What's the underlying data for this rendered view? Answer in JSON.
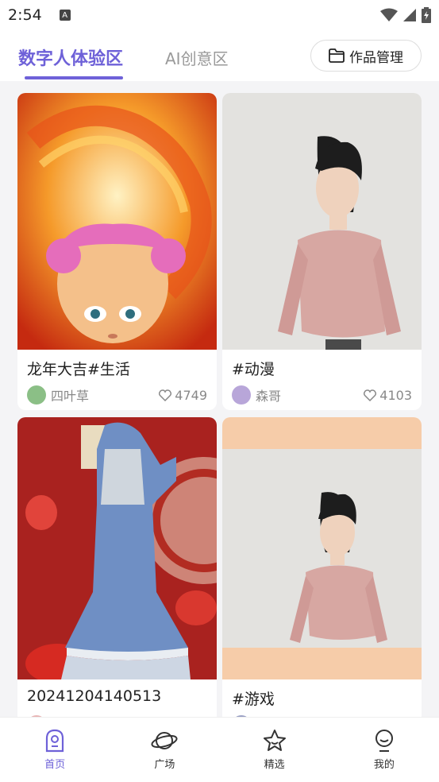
{
  "status_bar": {
    "time": "2:54",
    "notification_icon": "A"
  },
  "header": {
    "tabs": [
      {
        "label": "数字人体验区",
        "active": true
      },
      {
        "label": "AI创意区",
        "active": false
      }
    ],
    "manage_button": "作品管理"
  },
  "cards": [
    {
      "title": "龙年大吉#生活",
      "author": "四叶草",
      "likes": "4749",
      "avatar_color": "#8bbf86",
      "image": "dragon-pink-hair-character"
    },
    {
      "title": "#动漫",
      "author": "森哥",
      "likes": "4103",
      "avatar_color": "#b8a6d9",
      "image": "female-avatar-pink-top"
    },
    {
      "title": "20241204140513",
      "author": "",
      "likes": "",
      "avatar_color": "#e8b4b4",
      "image": "blue-dress-red-background"
    },
    {
      "title": "#游戏",
      "author": "",
      "likes": "",
      "avatar_color": "#9aa0c4",
      "image": "female-avatar-peach-background"
    }
  ],
  "bottom_nav": [
    {
      "label": "首页",
      "icon": "robot-home-icon",
      "active": true
    },
    {
      "label": "广场",
      "icon": "planet-icon",
      "active": false
    },
    {
      "label": "精选",
      "icon": "star-icon",
      "active": false
    },
    {
      "label": "我的",
      "icon": "profile-icon",
      "active": false
    }
  ],
  "colors": {
    "accent": "#6e61d8"
  }
}
